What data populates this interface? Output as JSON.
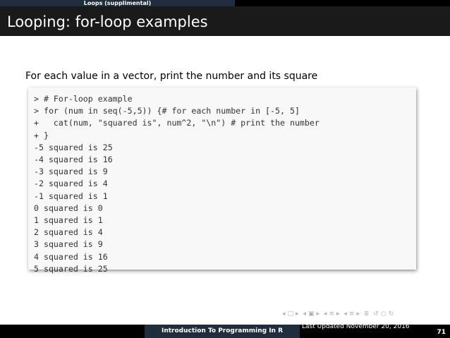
{
  "header": {
    "section": "Loops (supplimental)",
    "title": "Looping: for-loop examples"
  },
  "content": {
    "lead": "For each value in a vector, print the number and its square",
    "code_lines": [
      "> # For-loop example",
      "> for (num in seq(-5,5)) {# for each number in [-5, 5]",
      "+   cat(num, \"squared is\", num^2, \"\\n\") # print the number",
      "+ }",
      "-5 squared is 25",
      "-4 squared is 16",
      "-3 squared is 9",
      "-2 squared is 4",
      "-1 squared is 1",
      "0 squared is 0",
      "1 squared is 1",
      "2 squared is 4",
      "3 squared is 9",
      "4 squared is 16",
      "5 squared is 25"
    ]
  },
  "footer": {
    "course": "Introduction To Programming In R",
    "updated": "Last Updated November 20, 2016",
    "page": "71"
  },
  "colors": {
    "header_bg": "#1a1a1a",
    "section_bg": "#1f2d3f",
    "code_bg": "#f8f8f8"
  }
}
